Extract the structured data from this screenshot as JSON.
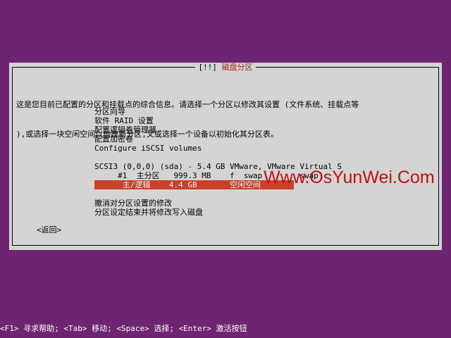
{
  "dialog": {
    "title_left": "[!!]",
    "title_text": "磁盘分区",
    "description_line1": "这是您目前已配置的分区和挂载点的综合信息。请选择一个分区以修改其设置 (文件系统、挂载点等",
    "description_line2": "),或选择一块空闲空间以创建新分区,又或选择一个设备以初始化其分区表。",
    "menu": {
      "guided_partitioning": "分区向导",
      "software_raid": "软件 RAID 设置",
      "lvm": "配置逻辑卷管理器",
      "encrypted": "配置加密卷",
      "iscsi": "Configure iSCSI volumes",
      "disk": "SCSI3 (0,0,0) (sda) - 5.4 GB VMware, VMware Virtual S",
      "partition1": "     #1  主分区   999.3 MB    f  swap        swap",
      "free_space": "      主/逻辑    4.4 GB       空闲空间",
      "undo": "撤消对分区设置的修改",
      "finish": "分区设定结束并将修改写入磁盘"
    },
    "back_button": "<返回>"
  },
  "statusbar": {
    "text": "<F1> 寻求帮助; <Tab> 移动; <Space> 选择; <Enter> 激活按钮"
  },
  "watermark": "Www.OsYunWei.Com",
  "colors": {
    "background": "#6e2571",
    "dialog": "#d4d4d4",
    "title": "#a0201a",
    "selection": "#c8402c",
    "watermark": "#c01010"
  }
}
